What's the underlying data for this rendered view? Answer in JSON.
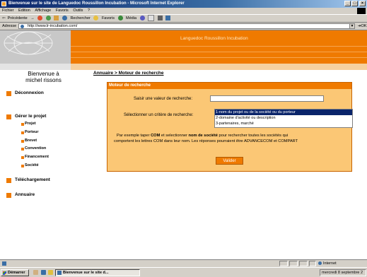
{
  "window": {
    "title": "Bienvenue sur le site de Languedoc Roussillon Incubation - Microsoft Internet Explorer",
    "controls": [
      "_",
      "□",
      "×"
    ]
  },
  "menu": [
    "Fichier",
    "Edition",
    "Affichage",
    "Favoris",
    "Outils",
    "?"
  ],
  "toolbar": {
    "back": "Précédente",
    "search": "Rechercher",
    "favorites": "Favoris",
    "media": "Média"
  },
  "address": {
    "label": "Adresse",
    "url": "http://www.lr-incubation.com/",
    "go": "OK"
  },
  "banner": {
    "title": "Languedoc Roussillon Incubation"
  },
  "sidebar": {
    "welcome_line1": "Bienvenue à",
    "welcome_line2": "michel rissons",
    "logout": "Déconnexion",
    "manage": "Gérer le projet",
    "sub_items": [
      "Projet",
      "Porteur",
      "Brevet",
      "Convention",
      "Financement",
      "Société"
    ],
    "download": "Téléchargement",
    "directory": "Annuaire"
  },
  "breadcrumb": "Annuaire > Moteur de recherche",
  "search_panel": {
    "header": "Moteur de recherche",
    "search_label": "Saisir une valeur de recherche:",
    "search_value": "",
    "criteria_label": "Sélectionner un critère de recherche:",
    "criteria_options": [
      "1-nom du projet ou de la société ou du porteur",
      "2-domaine d'activité ou description",
      "3-partenaires, marché"
    ],
    "selected_index": 0,
    "example_line1_a": "Par exemple taper ",
    "example_line1_b": "COM",
    "example_line1_c": " et selectionner ",
    "example_line1_d": "nom de société",
    "example_line1_e": " pour rechercher toutes les sociétés qui",
    "example_line2": "comportent les lettres COM dans leur nom. Les réponses pourraient être ADVANCECOM et COMPART",
    "submit": "Valider"
  },
  "status": {
    "zone": "Internet"
  },
  "taskbar": {
    "start": "Démarrer",
    "active_window": "Bienvenue sur le site d...",
    "clock": "mercredi 8 septembre 2"
  },
  "colors": {
    "accent": "#ef7a00",
    "panel_bg": "#fbc775",
    "selection": "#0a246a"
  }
}
